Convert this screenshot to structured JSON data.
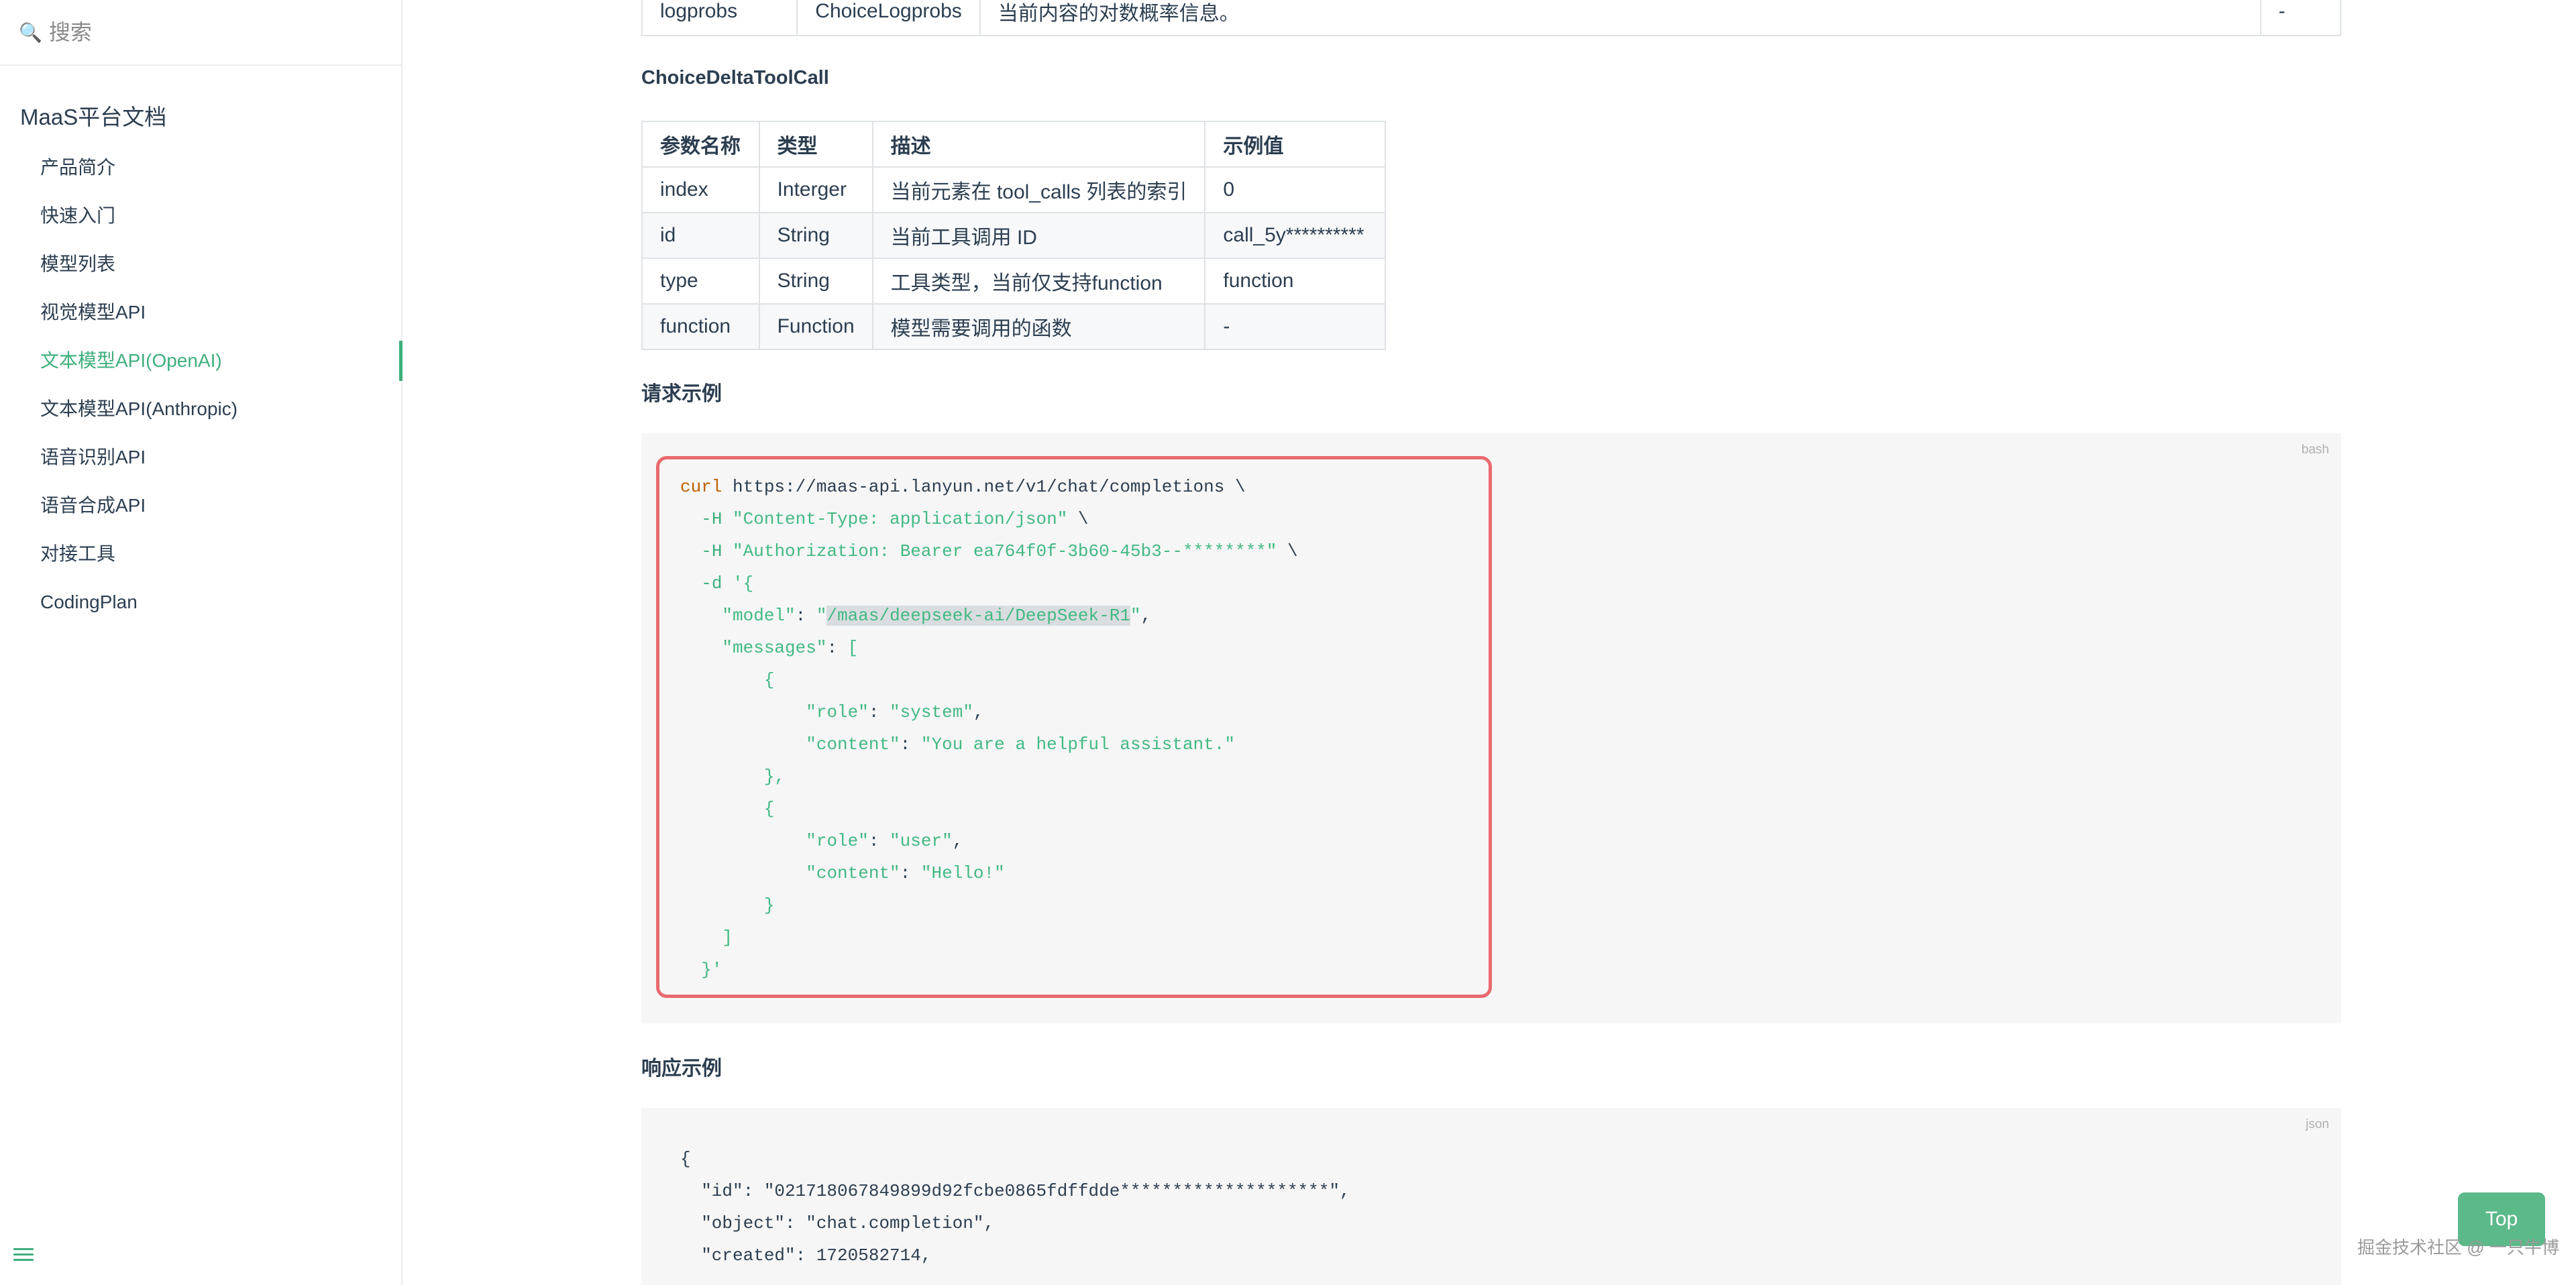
{
  "sidebar": {
    "search": {
      "placeholder": "搜索"
    },
    "title": "MaaS平台文档",
    "items": [
      {
        "label": "产品简介"
      },
      {
        "label": "快速入门"
      },
      {
        "label": "模型列表"
      },
      {
        "label": "视觉模型API"
      },
      {
        "label": "文本模型API(OpenAI)",
        "active": true
      },
      {
        "label": "文本模型API(Anthropic)"
      },
      {
        "label": "语音识别API"
      },
      {
        "label": "语音合成API"
      },
      {
        "label": "对接工具"
      },
      {
        "label": "CodingPlan"
      }
    ]
  },
  "main": {
    "top_row": [
      "logprobs",
      "ChoiceLogprobs",
      "当前内容的对数概率信息。",
      "-"
    ],
    "tool_call_section": {
      "heading": "ChoiceDeltaToolCall",
      "headers": [
        "参数名称",
        "类型",
        "描述",
        "示例值"
      ],
      "rows": [
        [
          "index",
          "Interger",
          "当前元素在 tool_calls 列表的索引",
          "0"
        ],
        [
          "id",
          "String",
          "当前工具调用 ID",
          "call_5y**********"
        ],
        [
          "type",
          "String",
          "工具类型，当前仅支持function",
          "function"
        ],
        [
          "function",
          "Function",
          "模型需要调用的函数",
          "-"
        ]
      ]
    },
    "request_example": {
      "heading": "请求示例",
      "lang": "bash",
      "curl": "curl",
      "url": " https://maas-api.lanyun.net/v1/chat/completions \\",
      "h_flag": "-H",
      "header_content_type": "\"Content-Type: application/json\"",
      "header_auth": "\"Authorization: Bearer ea764f0f-3b60-45b3--********\"",
      "d_flag": "-d",
      "body_open": "'{",
      "model_key": "\"model\"",
      "model_value": "/maas/deepseek-ai/DeepSeek-R1",
      "messages_key": "\"messages\"",
      "role_key": "\"role\"",
      "content_key": "\"content\"",
      "role_system": "\"system\"",
      "content_system": "\"You are a helpful assistant.\"",
      "role_user": "\"user\"",
      "content_user": "\"Hello!\"",
      "body_close": "}'"
    },
    "response_example": {
      "heading": "响应示例",
      "lang": "json",
      "lines": [
        "{",
        "  \"id\": \"021718067849899d92fcbe0865fdffdde********************\",",
        "  \"object\": \"chat.completion\",",
        "  \"created\": 1720582714,"
      ]
    }
  },
  "top_button": "Top",
  "watermark": "掘金技术社区 @ 一只牛博"
}
